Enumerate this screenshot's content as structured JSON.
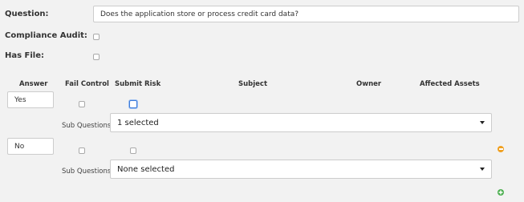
{
  "form": {
    "question_label": "Question:",
    "question_value": "Does the application store or process credit card data?",
    "compliance_label": "Compliance Audit:",
    "hasfile_label": "Has File:"
  },
  "answers_table": {
    "headers": {
      "answer": "Answer",
      "fail_control": "Fail Control",
      "submit_risk": "Submit Risk",
      "subject": "Subject",
      "owner": "Owner",
      "affected_assets": "Affected Assets"
    },
    "rows": [
      {
        "answer": "Yes",
        "fail_control_checked": false,
        "submit_risk_checked": false,
        "sub_questions_label": "Sub Questions:",
        "sub_questions_value": "1 selected"
      },
      {
        "answer": "No",
        "fail_control_checked": false,
        "submit_risk_checked": false,
        "sub_questions_label": "Sub Questions:",
        "sub_questions_value": "None selected"
      }
    ]
  },
  "icons": {
    "remove": "minus-circle-icon",
    "add": "plus-circle-icon",
    "remove_color": "#f0a020",
    "add_color": "#4caf50"
  }
}
